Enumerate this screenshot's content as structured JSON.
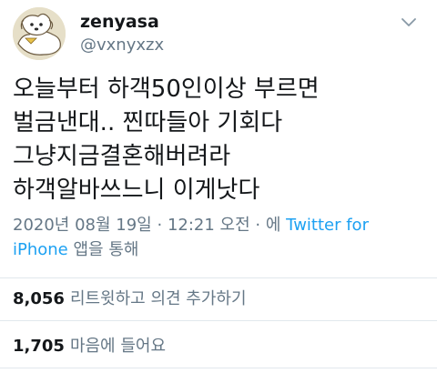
{
  "user": {
    "display_name": "zenyasa",
    "username": "@vxnyxzx",
    "avatar_icon": "puppy-avatar-icon"
  },
  "tweet": {
    "lines": [
      "오늘부터 하객50인이상 부르면",
      "벌금낸대.. 찐따들아 기회다",
      "그냥지금결혼해버려라",
      "하객알바쓰느니 이게낫다"
    ]
  },
  "meta": {
    "date": "2020년 08월 19일",
    "time": "12:21 오전",
    "via_prefix": "에",
    "via_link": "Twitter for iPhone",
    "via_suffix": "앱을 통해",
    "separator": "·"
  },
  "stats": {
    "retweets": {
      "count": "8,056",
      "label": "리트윗하고 의견 추가하기"
    },
    "likes": {
      "count": "1,705",
      "label": "마음에 들어요"
    }
  },
  "colors": {
    "link": "#1da1f2",
    "secondary": "#657786",
    "divider": "#e1e8ed"
  }
}
